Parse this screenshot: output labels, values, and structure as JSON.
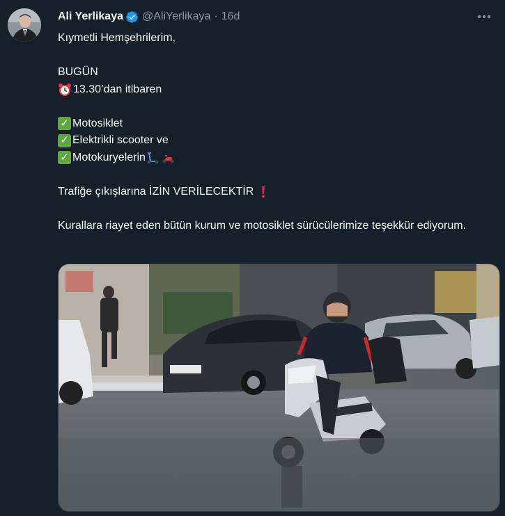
{
  "author": {
    "name": "Ali Yerlikaya",
    "handle": "@AliYerlikaya",
    "separator": "·",
    "time": "16d"
  },
  "icons": {
    "avatar": "profile-photo",
    "verified": "verified-badge-icon",
    "more": "more-options-icon",
    "alarm": "alarm-clock-emoji",
    "check": "check-mark-button-emoji",
    "scooter": "kick-scooter-emoji",
    "motor_scooter": "motor-scooter-emoji",
    "exclamation": "red-exclamation-emoji"
  },
  "colors": {
    "background": "#15202b",
    "text": "#f7f9f9",
    "secondary": "#8b98a5",
    "verified": "#1d9bf0",
    "check_emoji": "#5fa83c",
    "exclamation": "#e0245e"
  },
  "tweet": {
    "greeting": "Kıymetli Hemşehrilerim,",
    "today": "BUGÜN",
    "time_line": "13.30’dan itibaren",
    "item1": "Motosiklet",
    "item2": "Elektrikli scooter ve",
    "item3": "Motokuryelerin",
    "traffic_prefix": "Trafiğe çıkışlarına ",
    "traffic_bold": "İZİN VERİLECEKTİR",
    "thanks": "Kurallara riayet eden bütün kurum ve motosiklet sürücülerimize teşekkür ediyorum."
  },
  "media": {
    "description_icon": "photo-of-scooter-rider-in-rain"
  }
}
